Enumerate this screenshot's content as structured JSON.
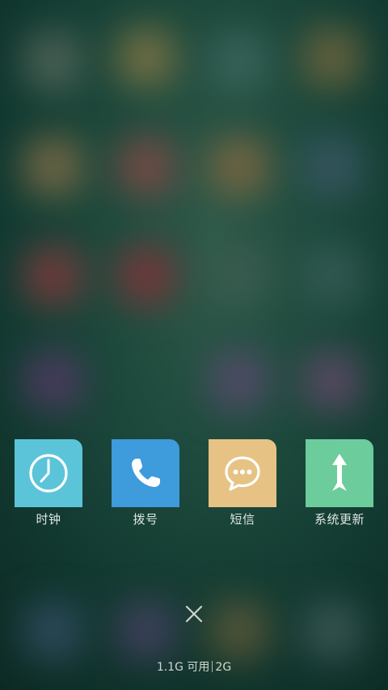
{
  "recent_apps": [
    {
      "label": "时钟",
      "icon": "clock-icon",
      "color": "#5cc4d9"
    },
    {
      "label": "拨号",
      "icon": "phone-icon",
      "color": "#3e9bdc"
    },
    {
      "label": "短信",
      "icon": "message-bubble-icon",
      "color": "#e6c384"
    },
    {
      "label": "系统更新",
      "icon": "update-arrow-icon",
      "color": "#6dcc9c"
    }
  ],
  "close_icon": "close-icon",
  "memory": {
    "available": "1.1G 可用",
    "total": "2G"
  }
}
